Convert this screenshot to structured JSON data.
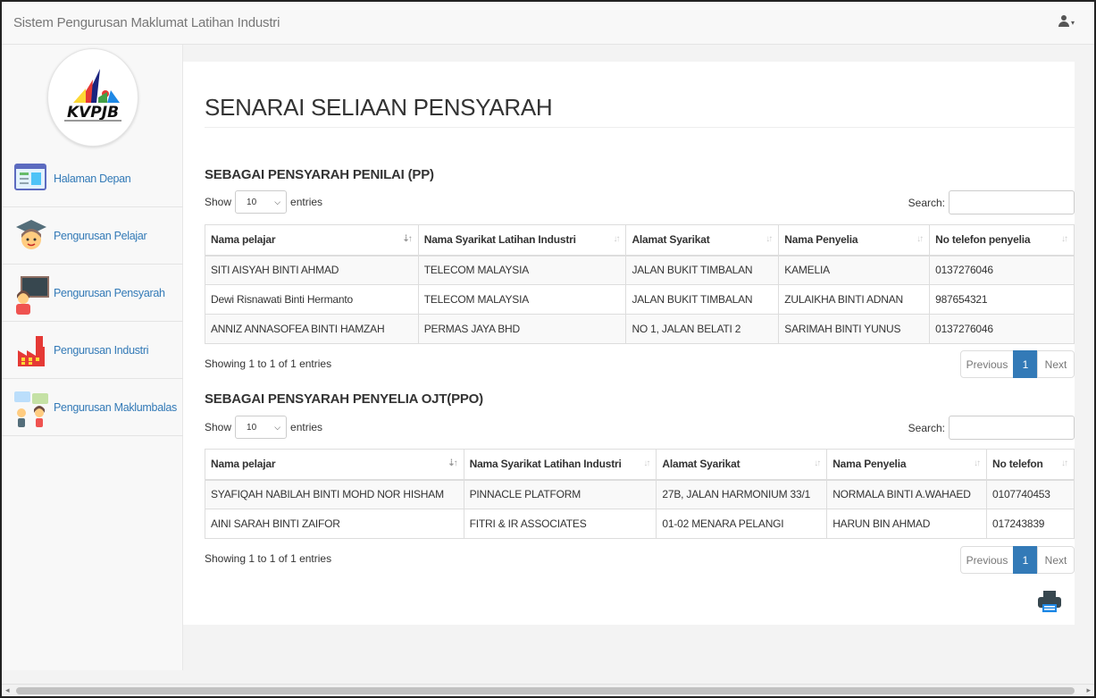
{
  "app": {
    "title": "Sistem Pengurusan Maklumat Latihan Industri"
  },
  "user_menu": {
    "icon": "user-icon",
    "caret": "▾"
  },
  "logo": {
    "text": "KVPJB"
  },
  "sidebar": {
    "items": [
      {
        "label": "Halaman Depan",
        "icon": "home-page-icon"
      },
      {
        "label": "Pengurusan Pelajar",
        "icon": "student-icon"
      },
      {
        "label": "Pengurusan Pensyarah",
        "icon": "lecturer-icon"
      },
      {
        "label": "Pengurusan Industri",
        "icon": "factory-icon"
      },
      {
        "label": "Pengurusan Maklumbalas",
        "icon": "feedback-icon"
      }
    ]
  },
  "page": {
    "title": "SENARAI SELIAAN PENSYARAH"
  },
  "section_pp": {
    "title": "SEBAGAI PENSYARAH PENILAI (PP)",
    "show_label": "Show",
    "entries_value": "10",
    "entries_label": "entries",
    "search_label": "Search:",
    "columns": [
      "Nama pelajar",
      "Nama Syarikat Latihan Industri",
      "Alamat Syarikat",
      "Nama Penyelia",
      "No telefon penyelia"
    ],
    "rows": [
      [
        "SITI AISYAH BINTI AHMAD",
        "TELECOM MALAYSIA",
        "JALAN BUKIT TIMBALAN",
        "KAMELIA",
        "0137276046"
      ],
      [
        "Dewi Risnawati Binti Hermanto",
        "TELECOM MALAYSIA",
        "JALAN BUKIT TIMBALAN",
        "ZULAIKHA BINTI ADNAN",
        "987654321"
      ],
      [
        "ANNIZ ANNASOFEA BINTI HAMZAH",
        "PERMAS JAYA BHD",
        "NO 1, JALAN BELATI 2",
        "SARIMAH BINTI YUNUS",
        "0137276046"
      ]
    ],
    "info": "Showing 1 to 1 of 1 entries",
    "pager": {
      "previous": "Previous",
      "page": "1",
      "next": "Next"
    }
  },
  "section_ppo": {
    "title": "SEBAGAI PENSYARAH PENYELIA OJT(PPO)",
    "show_label": "Show",
    "entries_value": "10",
    "entries_label": "entries",
    "search_label": "Search:",
    "columns": [
      "Nama pelajar",
      "Nama Syarikat Latihan Industri",
      "Alamat Syarikat",
      "Nama Penyelia",
      "No telefon"
    ],
    "rows": [
      [
        "SYAFIQAH NABILAH BINTI MOHD NOR HISHAM",
        "PINNACLE PLATFORM",
        "27B, JALAN HARMONIUM 33/1",
        "NORMALA BINTI A.WAHAED",
        "0107740453"
      ],
      [
        "AINI SARAH BINTI ZAIFOR",
        "FITRI & IR ASSOCIATES",
        "01-02 MENARA PELANGI",
        "HARUN BIN AHMAD",
        "017243839"
      ]
    ],
    "info": "Showing 1 to 1 of 1 entries",
    "pager": {
      "previous": "Previous",
      "page": "1",
      "next": "Next"
    }
  },
  "print": {
    "icon": "printer-icon"
  },
  "colors": {
    "link": "#337ab7",
    "active_page": "#337ab7",
    "navbar": "#f8f8f8"
  }
}
